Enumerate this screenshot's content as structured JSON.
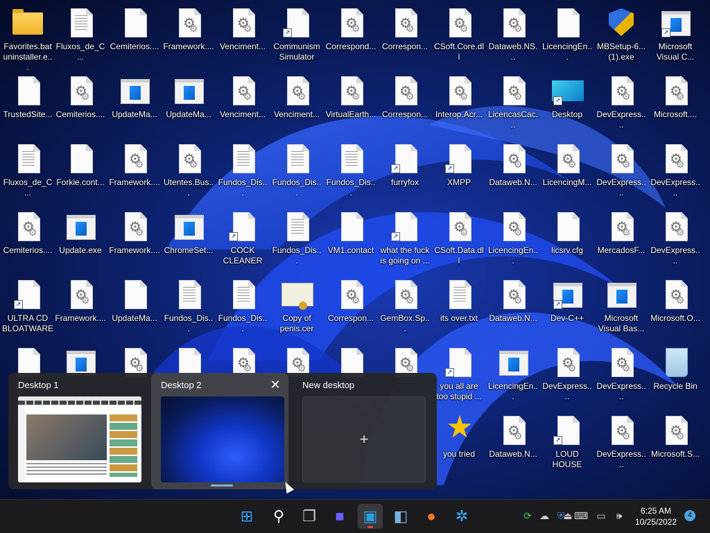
{
  "desktop": {
    "rows": [
      [
        {
          "label": "Favorites.bat\nuninstaller.e...",
          "icon": "folder-icon"
        },
        {
          "label": "Fluxos_de_C...",
          "icon": "text-file-icon"
        },
        {
          "label": "Cemiterios....",
          "icon": "blank-file-icon"
        },
        {
          "label": "Framework....",
          "icon": "config-file-icon"
        },
        {
          "label": "Venciment...",
          "icon": "config-file-icon"
        },
        {
          "label": "Communism Simulator",
          "icon": "shortcut-file-icon"
        },
        {
          "label": "Correspond...",
          "icon": "config-file-icon"
        },
        {
          "label": "Correspon...",
          "icon": "config-file-icon"
        },
        {
          "label": "CSoft.Core.dll",
          "icon": "config-file-icon"
        },
        {
          "label": "Dataweb.NS...",
          "icon": "config-file-icon"
        },
        {
          "label": "LicencingEn...",
          "icon": "blank-file-icon"
        },
        {
          "label": "MBSetup-6... (1).exe",
          "icon": "installer-shield-icon"
        },
        {
          "label": "Microsoft Visual C...",
          "icon": "app-window-shortcut-icon"
        }
      ],
      [
        {
          "label": "TrustedSite...",
          "icon": "blank-file-icon"
        },
        {
          "label": "Cemiterios....",
          "icon": "config-file-icon"
        },
        {
          "label": "UpdateMa...",
          "icon": "app-window-icon"
        },
        {
          "label": "UpdateMa...",
          "icon": "app-window-icon"
        },
        {
          "label": "Venciment...",
          "icon": "config-file-icon"
        },
        {
          "label": "Venciment...",
          "icon": "config-file-icon"
        },
        {
          "label": "VirtualEarth...",
          "icon": "config-file-icon"
        },
        {
          "label": "Correspon...",
          "icon": "config-file-icon"
        },
        {
          "label": "Interop.Acr...",
          "icon": "config-file-icon"
        },
        {
          "label": "LicencasCac...",
          "icon": "config-file-icon"
        },
        {
          "label": "Desktop",
          "icon": "desktop-shortcut-icon"
        },
        {
          "label": "DevExpress....",
          "icon": "config-file-icon"
        },
        {
          "label": "Microsoft....",
          "icon": "config-file-icon"
        }
      ],
      [
        {
          "label": "Fluxos_de_C...",
          "icon": "text-file-icon"
        },
        {
          "label": "Forkie.cont...",
          "icon": "blank-file-icon"
        },
        {
          "label": "Framework....",
          "icon": "config-file-icon"
        },
        {
          "label": "Utentes.Bus...",
          "icon": "config-file-icon"
        },
        {
          "label": "Fundos_Dis...",
          "icon": "text-file-icon"
        },
        {
          "label": "Fundos_Dis...",
          "icon": "text-file-icon"
        },
        {
          "label": "Fundos_Dis...",
          "icon": "text-file-icon"
        },
        {
          "label": "furryfox",
          "icon": "shortcut-file-icon"
        },
        {
          "label": "XMPP",
          "icon": "shortcut-file-icon"
        },
        {
          "label": "Dataweb.N...",
          "icon": "config-file-icon"
        },
        {
          "label": "LicencingM...",
          "icon": "config-file-icon"
        },
        {
          "label": "DevExpress....",
          "icon": "config-file-icon"
        },
        {
          "label": "DevExpress....",
          "icon": "config-file-icon"
        }
      ],
      [
        {
          "label": "Cemiterios....",
          "icon": "config-file-icon"
        },
        {
          "label": "Update.exe",
          "icon": "app-window-icon"
        },
        {
          "label": "Framework....",
          "icon": "config-file-icon"
        },
        {
          "label": "ChromeSet...",
          "icon": "app-window-icon"
        },
        {
          "label": "COCK CLEANER",
          "icon": "shortcut-file-icon"
        },
        {
          "label": "Fundos_Dis...",
          "icon": "text-file-icon"
        },
        {
          "label": "VM1.contact",
          "icon": "blank-file-icon"
        },
        {
          "label": "what the fuck is going on ...",
          "icon": "shortcut-file-icon"
        },
        {
          "label": "CSoft.Data.dll",
          "icon": "config-file-icon"
        },
        {
          "label": "LicencingEn...",
          "icon": "config-file-icon"
        },
        {
          "label": "licsrv.cfg",
          "icon": "blank-file-icon"
        },
        {
          "label": "MercadosF...",
          "icon": "config-file-icon"
        },
        {
          "label": "DevExpress....",
          "icon": "config-file-icon"
        }
      ],
      [
        {
          "label": "ULTRA CD BLOATWARE",
          "icon": "shortcut-file-icon"
        },
        {
          "label": "Framework....",
          "icon": "config-file-icon"
        },
        {
          "label": "UpdateMa...",
          "icon": "blank-file-icon"
        },
        {
          "label": "Fundos_Dis...",
          "icon": "text-file-icon"
        },
        {
          "label": "Fundos_Dis...",
          "icon": "text-file-icon"
        },
        {
          "label": "Copy of penis.cer",
          "icon": "certificate-icon"
        },
        {
          "label": "Correspon...",
          "icon": "config-file-icon"
        },
        {
          "label": "GemBox.Sp...",
          "icon": "config-file-icon"
        },
        {
          "label": "its over.txt",
          "icon": "text-file-icon"
        },
        {
          "label": "Dataweb.N...",
          "icon": "config-file-icon"
        },
        {
          "label": "Dev-C++",
          "icon": "app-window-shortcut-icon"
        },
        {
          "label": "Microsoft Visual Bas...",
          "icon": "app-window-icon"
        },
        {
          "label": "Microsoft.O...",
          "icon": "config-file-icon"
        }
      ],
      [
        {
          "label": "",
          "icon": "blank-file-icon"
        },
        {
          "label": "",
          "icon": "app-window-icon"
        },
        {
          "label": "",
          "icon": "config-file-icon"
        },
        {
          "label": "",
          "icon": "blank-file-icon"
        },
        {
          "label": "",
          "icon": "config-file-icon"
        },
        {
          "label": "",
          "icon": "config-file-icon"
        },
        {
          "label": "",
          "icon": "blank-file-icon"
        },
        {
          "label": "",
          "icon": "config-file-icon"
        },
        {
          "label": "you all are too stupid ...",
          "icon": "shortcut-file-icon"
        },
        {
          "label": "LicencingEn...",
          "icon": "app-window-icon"
        },
        {
          "label": "DevExpress....",
          "icon": "config-file-icon"
        },
        {
          "label": "DevExpress....",
          "icon": "config-file-icon"
        },
        {
          "label": "Recycle Bin",
          "icon": "recycle-bin-icon"
        }
      ],
      [
        {
          "label": "",
          "icon": ""
        },
        {
          "label": "",
          "icon": ""
        },
        {
          "label": "",
          "icon": ""
        },
        {
          "label": "",
          "icon": ""
        },
        {
          "label": "",
          "icon": ""
        },
        {
          "label": "",
          "icon": ""
        },
        {
          "label": "",
          "icon": ""
        },
        {
          "label": "",
          "icon": ""
        },
        {
          "label": "you tried",
          "icon": "star-icon"
        },
        {
          "label": "Dataweb.N...",
          "icon": "config-file-icon"
        },
        {
          "label": "LOUD HOUSE",
          "icon": "shortcut-file-icon"
        },
        {
          "label": "DevExpress....",
          "icon": "config-file-icon"
        },
        {
          "label": "Microsoft.S...",
          "icon": "config-file-icon"
        }
      ]
    ]
  },
  "task_view": {
    "desktops": [
      {
        "title": "Desktop 1",
        "thumbnail": "youtube-page"
      },
      {
        "title": "Desktop 2",
        "thumbnail": "wallpaper"
      }
    ],
    "new_desktop_label": "New desktop",
    "new_desktop_plus": "+",
    "close_glyph": "✕"
  },
  "taskbar": {
    "apps": [
      {
        "name": "start-button",
        "glyph": "⊞",
        "color": "#3aa0ff"
      },
      {
        "name": "search-button",
        "glyph": "⚲",
        "color": "#ffffff"
      },
      {
        "name": "task-view-button",
        "glyph": "❐",
        "color": "#cfcfcf"
      },
      {
        "name": "chat-button",
        "glyph": "■",
        "color": "#6a5cff"
      },
      {
        "name": "remote-desktop-button",
        "glyph": "▣",
        "color": "#2aa0e6",
        "active": true
      },
      {
        "name": "control-panel-button",
        "glyph": "◧",
        "color": "#7ab0e0"
      },
      {
        "name": "firefox-button",
        "glyph": "●",
        "color": "#ff7a1a"
      },
      {
        "name": "app-button",
        "glyph": "✲",
        "color": "#3ab0ff"
      }
    ],
    "tray": [
      {
        "name": "sync-icon",
        "glyph": "⟳",
        "color": "#3ccf4e"
      },
      {
        "name": "cloud-offline-icon",
        "glyph": "☁",
        "color": "#cfcfcf"
      },
      {
        "name": "defender-shield-icon",
        "glyph": "⛨",
        "color": "#4a90e2"
      },
      {
        "name": "usb-icon",
        "glyph": "⏏",
        "color": "#cfcfcf"
      },
      {
        "name": "keyboard-icon",
        "glyph": "⌨",
        "color": "#cfcfcf"
      },
      {
        "name": "network-icon",
        "glyph": "▭",
        "color": "#cfcfcf"
      },
      {
        "name": "volume-icon",
        "glyph": "🕪",
        "color": "#cfcfcf"
      }
    ],
    "time": "6:25 AM",
    "date": "10/25/2022",
    "notifications": "4"
  }
}
